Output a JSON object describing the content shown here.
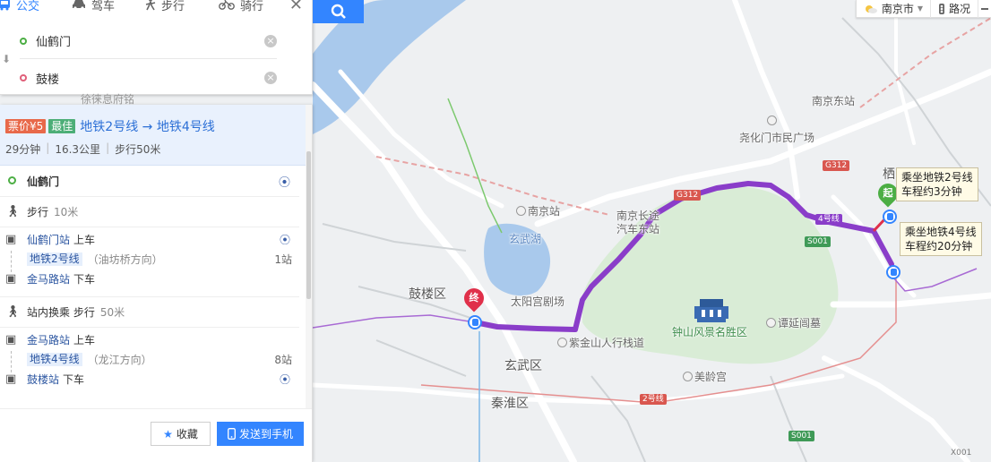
{
  "modes": [
    {
      "id": "bus",
      "icon": "bus-icon",
      "label": "公交"
    },
    {
      "id": "drive",
      "icon": "car-icon",
      "label": "驾车"
    },
    {
      "id": "walk",
      "icon": "walk-icon",
      "label": "步行"
    },
    {
      "id": "ride",
      "icon": "bike-icon",
      "label": "骑行"
    }
  ],
  "search": {
    "start": "仙鹤门",
    "end": "鼓楼",
    "faded_text": "徐徕息府铭"
  },
  "plan": {
    "price_tag": "票价¥5",
    "best_tag": "最佳",
    "title": "地铁2号线 → 地铁4号线",
    "duration": "29分钟",
    "distance": "16.3公里",
    "walk": "步行50米"
  },
  "steps": {
    "start_name": "仙鹤门",
    "walk_label": "步行",
    "walk_dist": "10米",
    "board1_station": "仙鹤门站",
    "board1_action": "上车",
    "line1_name": "地铁2号线",
    "line1_dir": "（油坊桥方向）",
    "line1_stops": "1站",
    "alight1_station": "金马路站",
    "alight1_action": "下车",
    "transfer_label": "站内换乘 步行",
    "transfer_dist": "50米",
    "board2_station": "金马路站",
    "board2_action": "上车",
    "line2_name": "地铁4号线",
    "line2_dir": "（龙江方向）",
    "line2_stops": "8站",
    "alight2_station": "鼓楼站",
    "alight2_action": "下车"
  },
  "footer": {
    "fav_label": "收藏",
    "send_label": "发送到手机"
  },
  "map_controls": {
    "city": "南京市",
    "traffic": "路况"
  },
  "map_labels": {
    "nanjing_east": "南京东站",
    "yaohuamen": "尧化门市民广场",
    "nanjing_station": "南京站",
    "long_distance_1": "南京长途",
    "long_distance_2": "汽车东站",
    "xuanwu_lake": "玄武湖",
    "gulou_district": "鼓楼区",
    "taiyang_palace": "太阳宫剧场",
    "zijin_mountain": "紫金山人行栈道",
    "zhongshan": "钟山风景名胜区",
    "tanyanjian": "谭延闿墓",
    "xuanwu_district": "玄武区",
    "meiling": "美龄宫",
    "qinhuai": "秦淮区",
    "qi": "栖",
    "end_pin": "终",
    "start_pin": "起",
    "callout_line2_a": "乘坐地铁2号线",
    "callout_line2_b": "车程约3分钟",
    "callout_line4_a": "乘坐地铁4号线",
    "callout_line4_b": "车程约20分钟",
    "badge_g312_a": "G312",
    "badge_g312_b": "G312",
    "badge_4line": "4号线",
    "badge_2line": "2号线",
    "badge_s001_a": "S001",
    "badge_s001_b": "S001",
    "badge_x001": "X001"
  },
  "colors": {
    "accent": "#3385ff",
    "route": "#8a3dc9",
    "price_tag": "#e8694a",
    "best_tag": "#4cae77"
  }
}
